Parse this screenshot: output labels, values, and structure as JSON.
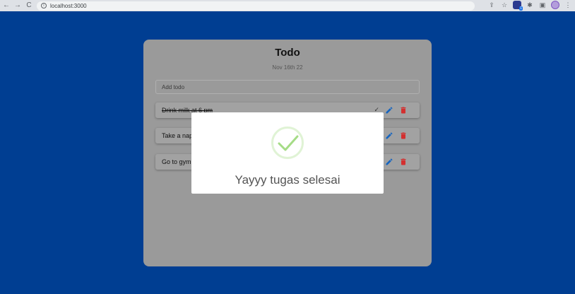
{
  "browser": {
    "url": "localhost:3000",
    "back_icon": "←",
    "forward_icon": "→",
    "reload_icon": "C"
  },
  "todo": {
    "title": "Todo",
    "date": "Nov 16th 22",
    "add_placeholder": "Add todo",
    "items": [
      {
        "text": "Drink milk at 6 pm",
        "done": true
      },
      {
        "text": "Take a nap",
        "done": false
      },
      {
        "text": "Go to gym",
        "done": false
      }
    ]
  },
  "modal": {
    "title": "Yayyy tugas selesai"
  },
  "colors": {
    "background": "#003e92",
    "card": "#9a9a9a",
    "edit": "#1565c0",
    "delete": "#d32f2f",
    "success": "#a5dc86"
  }
}
